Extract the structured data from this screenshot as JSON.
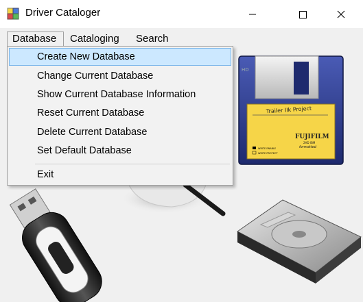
{
  "window": {
    "title": "Driver Cataloger"
  },
  "menubar": {
    "items": [
      {
        "label": "Database"
      },
      {
        "label": "Cataloging"
      },
      {
        "label": "Search"
      }
    ]
  },
  "database_menu": {
    "items": [
      {
        "label": "Create New Database",
        "highlighted": true
      },
      {
        "label": "Change Current Database"
      },
      {
        "label": "Show Current Database Information"
      },
      {
        "label": "Reset Current Database"
      },
      {
        "label": "Delete Current Database"
      },
      {
        "label": "Set Default Database"
      }
    ],
    "exit_label": "Exit"
  },
  "artwork": {
    "floppy_label": "Trailer IIk Project",
    "floppy_brand": "FUJIFILM",
    "floppy_spec": "2HD IBM",
    "floppy_formatted": "formatted",
    "floppy_write_enable": "WRITE ENABLE",
    "floppy_write_protect": "WRITE PROTECT"
  },
  "colors": {
    "menu_highlight": "#cce8ff",
    "menu_highlight_border": "#7bb6ea",
    "floppy_body": "#2b3a8f",
    "floppy_label": "#f6d548"
  }
}
